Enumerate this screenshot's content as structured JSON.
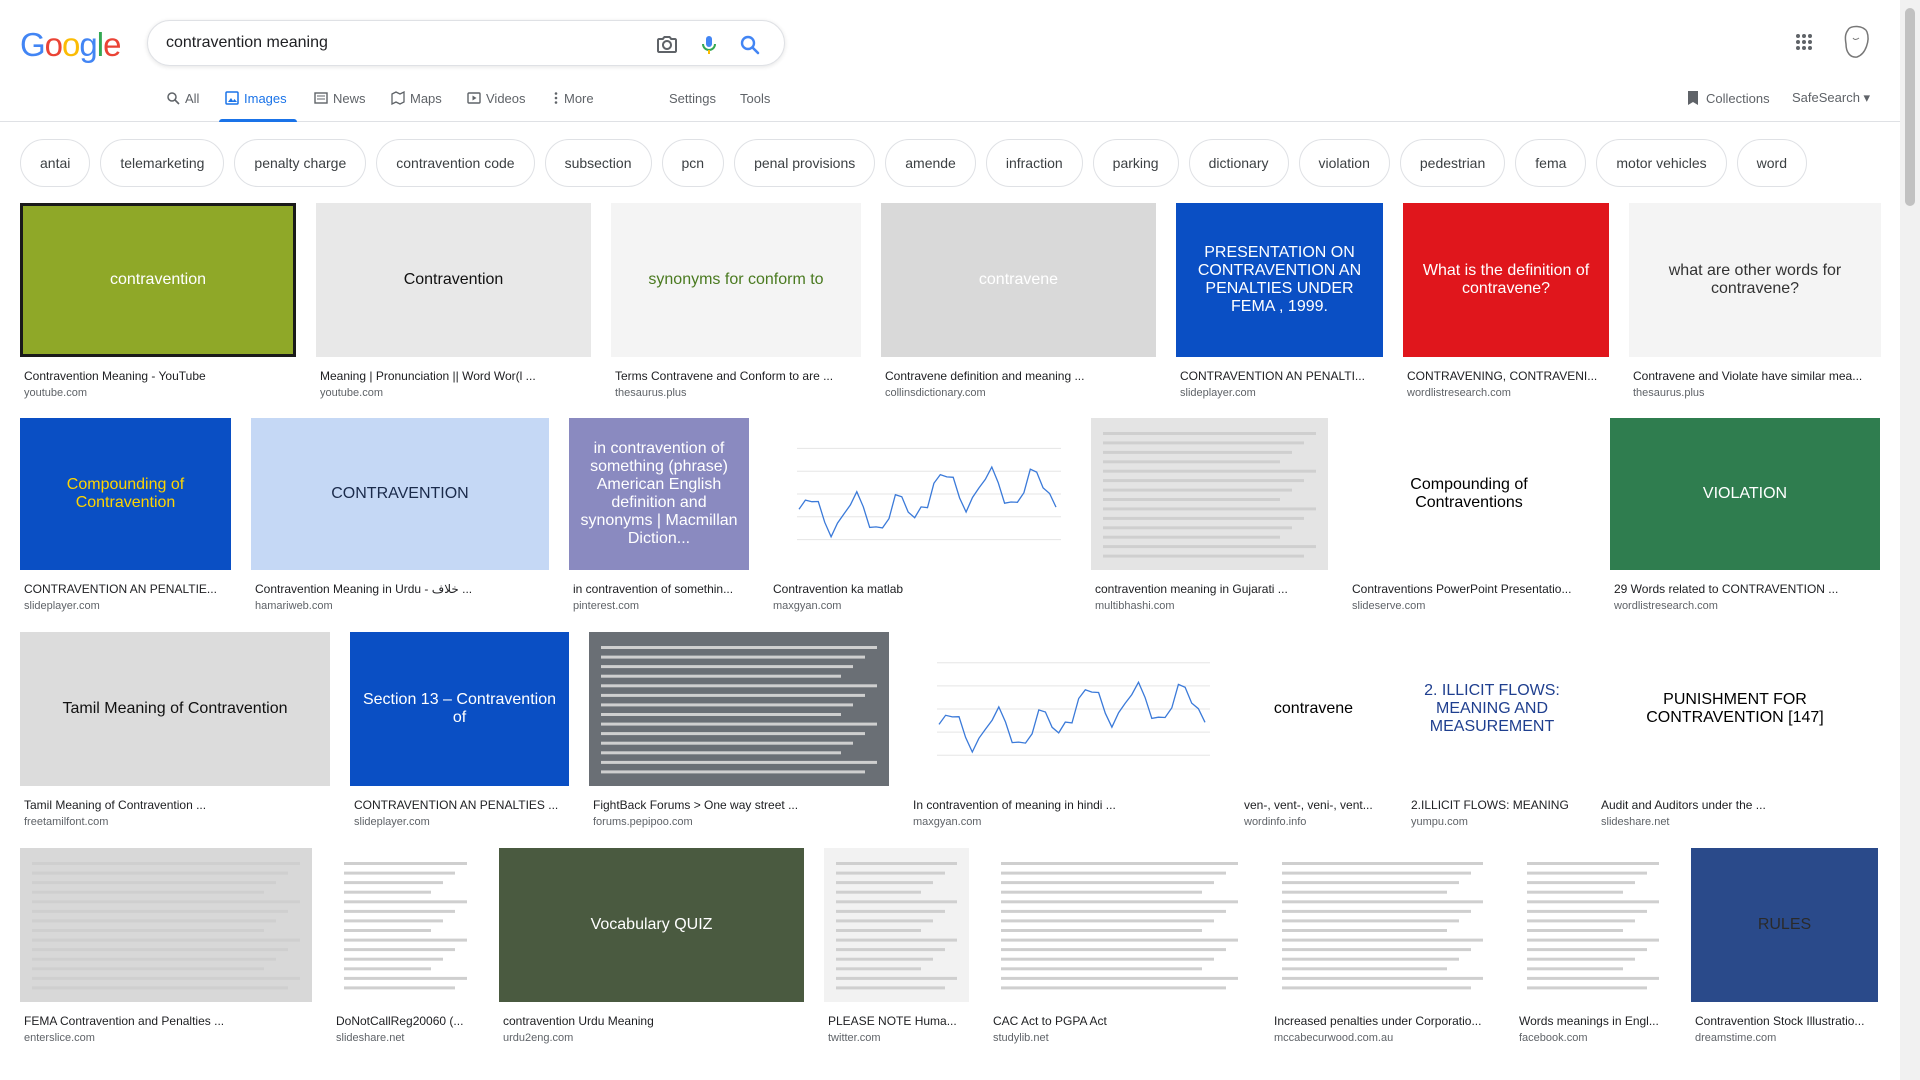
{
  "search": {
    "query": "contravention meaning",
    "placeholder": ""
  },
  "logo": {
    "letters": [
      "G",
      "o",
      "o",
      "g",
      "l",
      "e"
    ],
    "colors": [
      "#4285F4",
      "#EA4335",
      "#FBBC05",
      "#4285F4",
      "#34A853",
      "#EA4335"
    ]
  },
  "tabs": [
    {
      "label": "All",
      "icon": "search-icon"
    },
    {
      "label": "Images",
      "icon": "image-icon",
      "active": true
    },
    {
      "label": "News",
      "icon": "news-icon"
    },
    {
      "label": "Maps",
      "icon": "map-icon"
    },
    {
      "label": "Videos",
      "icon": "video-icon"
    },
    {
      "label": "More",
      "icon": "more-vert-icon"
    }
  ],
  "tools": {
    "settings": "Settings",
    "tools": "Tools",
    "collections": "Collections",
    "safesearch": "SafeSearch"
  },
  "chips": [
    "antai",
    "telemarketing",
    "penalty charge",
    "contravention code",
    "subsection",
    "pcn",
    "penal provisions",
    "amende",
    "infraction",
    "parking",
    "dictionary",
    "violation",
    "pedestrian",
    "fema",
    "motor vehicles",
    "word"
  ],
  "rows": [
    [
      {
        "caption": "Contravention Meaning - YouTube",
        "source": "youtube.com",
        "text": "contravention",
        "bg": "#8fa828",
        "fg": "#ffffff"
      },
      {
        "caption": "Meaning | Pronunciation || Word Wor(l ...",
        "source": "youtube.com",
        "text": "Contravention",
        "bg": "#e8e8e8",
        "fg": "#111111"
      },
      {
        "caption": "Terms Contravene and Conform to are ...",
        "source": "thesaurus.plus",
        "text": "synonyms for conform to",
        "bg": "#f4f4f4",
        "fg": "#4a7a20"
      },
      {
        "caption": "Contravene definition and meaning ...",
        "source": "collinsdictionary.com",
        "text": "contravene",
        "bg": "#d9d9d9",
        "fg": "#ffffff"
      },
      {
        "caption": "CONTRAVENTION AN PENALTI...",
        "source": "slideplayer.com",
        "text": "PRESENTATION ON CONTRAVENTION AN PENALTIES UNDER FEMA , 1999.",
        "bg": "#0a4fc4",
        "fg": "#ffffff"
      },
      {
        "caption": "CONTRAVENING, CONTRAVENI...",
        "source": "wordlistresearch.com",
        "text": "What is the definition of contravene?",
        "bg": "#e0161c",
        "fg": "#ffffff"
      },
      {
        "caption": "Contravene and Violate have similar mea...",
        "source": "thesaurus.plus",
        "text": "what are other words for contravene?",
        "bg": "#f4f4f4",
        "fg": "#333333"
      }
    ],
    [
      {
        "caption": "CONTRAVENTION AN PENALTIE...",
        "source": "slideplayer.com",
        "text": "Compounding of Contravention",
        "bg": "#0a4fc4",
        "fg": "#ffd400"
      },
      {
        "caption": "Contravention Meaning in Urdu - خلاف ...",
        "source": "hamariweb.com",
        "text": "CONTRAVENTION",
        "bg": "#c5d8f5",
        "fg": "#1a2a4a"
      },
      {
        "caption": "in contravention of somethin...",
        "source": "pinterest.com",
        "text": "in contravention of something (phrase) American English definition and synonyms | Macmillan Diction...",
        "bg": "#8a8ac0",
        "fg": "#ffffff"
      },
      {
        "caption": "Contravention ka matlab",
        "source": "maxgyan.com",
        "text": "",
        "bg": "#ffffff",
        "fg": "#3b7ad9"
      },
      {
        "caption": "contravention meaning in Gujarati ...",
        "source": "multibhashi.com",
        "text": "",
        "bg": "#e4e4e4",
        "fg": "#333333"
      },
      {
        "caption": "Contraventions PowerPoint Presentatio...",
        "source": "slideserve.com",
        "text": "Compounding of Contraventions",
        "bg": "#ffffff",
        "fg": "#000000"
      },
      {
        "caption": "29 Words related to CONTRAVENTION ...",
        "source": "wordlistresearch.com",
        "text": "VIOLATION",
        "bg": "#2f7d4f",
        "fg": "#ffffff"
      }
    ],
    [
      {
        "caption": "Tamil Meaning of Contravention ...",
        "source": "freetamilfont.com",
        "text": "Tamil Meaning of Contravention",
        "bg": "#dcdcdc",
        "fg": "#111111"
      },
      {
        "caption": "CONTRAVENTION AN PENALTIES ...",
        "source": "slideplayer.com",
        "text": "Section 13 – Contravention of",
        "bg": "#0a4fc4",
        "fg": "#ffffff"
      },
      {
        "caption": "FightBack Forums > One way street ...",
        "source": "forums.pepipoo.com",
        "text": "",
        "bg": "#6a6f75",
        "fg": "#ffffff"
      },
      {
        "caption": "In contravention of meaning in hindi ...",
        "source": "maxgyan.com",
        "text": "",
        "bg": "#ffffff",
        "fg": "#3b7ad9"
      },
      {
        "caption": "ven-, vent-, veni-, vent...",
        "source": "wordinfo.info",
        "text": "contravene",
        "bg": "#ffffff",
        "fg": "#000000"
      },
      {
        "caption": "2.ILLICIT FLOWS: MEANING",
        "source": "yumpu.com",
        "text": "2. ILLICIT FLOWS: MEANING AND MEASUREMENT",
        "bg": "#ffffff",
        "fg": "#1f3f8f"
      },
      {
        "caption": "Audit and Auditors under the ...",
        "source": "slideshare.net",
        "text": "PUNISHMENT FOR CONTRAVENTION [147]",
        "bg": "#ffffff",
        "fg": "#000000"
      }
    ],
    [
      {
        "caption": "FEMA Contravention and Penalties ...",
        "source": "enterslice.com",
        "text": "",
        "bg": "#d8d8d8",
        "fg": "#8a3b12"
      },
      {
        "caption": "DoNotCallReg20060 (...",
        "source": "slideshare.net",
        "text": "",
        "bg": "#ffffff",
        "fg": "#555555"
      },
      {
        "caption": "contravention Urdu Meaning",
        "source": "urdu2eng.com",
        "text": "Vocabulary QUIZ",
        "bg": "#4a5a40",
        "fg": "#ffffff"
      },
      {
        "caption": "PLEASE NOTE Huma...",
        "source": "twitter.com",
        "text": "",
        "bg": "#f2f2f2",
        "fg": "#555555"
      },
      {
        "caption": "CAC Act to PGPA Act",
        "source": "studylib.net",
        "text": "",
        "bg": "#ffffff",
        "fg": "#555555"
      },
      {
        "caption": "Increased penalties under Corporatio...",
        "source": "mccabecurwood.com.au",
        "text": "",
        "bg": "#ffffff",
        "fg": "#555555"
      },
      {
        "caption": "Words meanings in Engl...",
        "source": "facebook.com",
        "text": "",
        "bg": "#ffffff",
        "fg": "#333333"
      },
      {
        "caption": "Contravention Stock Illustratio...",
        "source": "dreamstime.com",
        "text": "RULES",
        "bg": "#2a4a8a",
        "fg": "#2a2a2a"
      }
    ]
  ]
}
